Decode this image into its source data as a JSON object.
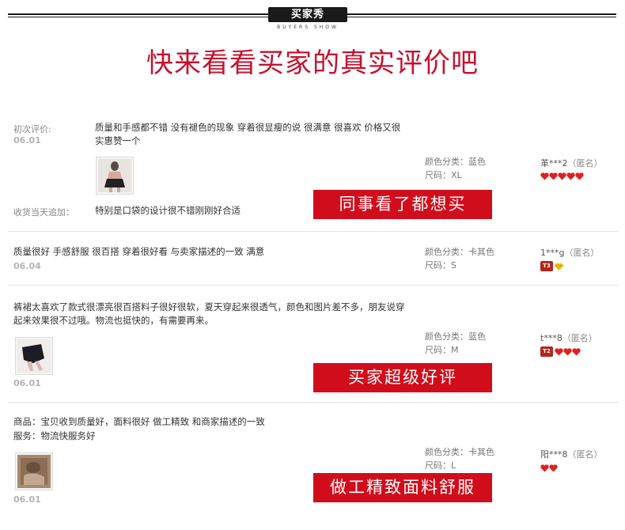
{
  "banner": {
    "badge": "买家秀",
    "subtitle": "BUYERS SHOW",
    "headline": "快来看看买家的真实评价吧"
  },
  "reviews": [
    {
      "label": "初次评价:",
      "date": "06.01",
      "text": "质量和手感都不错 没有褪色的现象 穿着很显瘦的说 很满意 很喜欢 价格又很实惠赞一个",
      "color": "颜色分类：蓝色",
      "size": "尺码：XL",
      "user": "革***2",
      "anon": "（匿名）",
      "hearts": 5,
      "followup_label": "收货当天追加：",
      "followup_text": "特别是口袋的设计很不错刚刚好合适",
      "promo": "同事看了都想买"
    },
    {
      "date": "06.04",
      "text": "质量很好 手感舒服 很百搭 穿着很好看 与卖家描述的一致 满意",
      "color": "颜色分类：卡其色",
      "size": "尺码：S",
      "user": "1***g",
      "anon": "（匿名）",
      "badge": "T3",
      "hearts": 0,
      "diamond": true
    },
    {
      "date": "06.01",
      "text": "裤裙太喜欢了款式很漂亮很百搭料子很好很软，夏天穿起来很透气，颜色和图片差不多，朋友说穿起来效果很不过哦。物流也挺快的，有需要再来。",
      "color": "颜色分类：蓝色",
      "size": "尺码：M",
      "user": "t***8",
      "anon": "（匿名）",
      "badge": "T2",
      "hearts": 3,
      "promo": "买家超级好评"
    },
    {
      "date": "06.01",
      "line1": "商品：宝贝收到质量好，面料很好 做工精致 和商家描述的一致",
      "line2": "服务：物流快服务好",
      "color": "颜色分类：卡其色",
      "size": "尺码：L",
      "user": "阳***8",
      "anon": "（匿名）",
      "hearts": 2,
      "promo": "做工精致面料舒服"
    }
  ],
  "colors": {
    "brand_red": "#d10d1c",
    "headline_red": "#c8102e",
    "heart_red": "#e02020"
  }
}
